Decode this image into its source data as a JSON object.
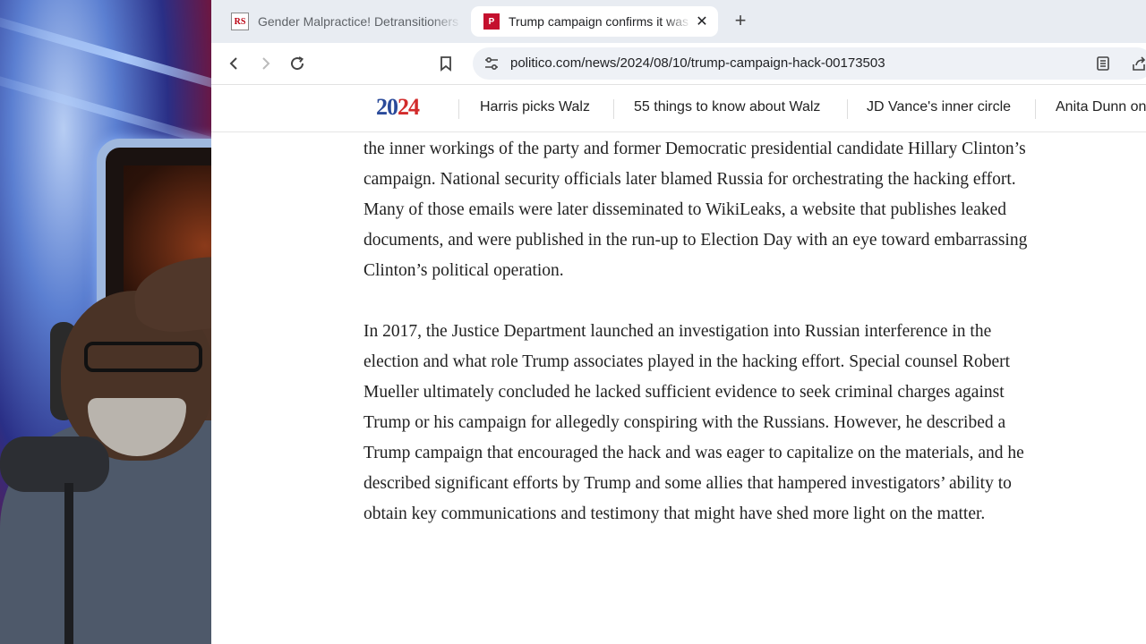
{
  "tabs": [
    {
      "favicon": "RS",
      "title": "Gender Malpractice! Detransitioners",
      "active": false
    },
    {
      "favicon": "P",
      "title": "Trump campaign confirms it was hacked",
      "active": true
    }
  ],
  "tab_close_glyph": "✕",
  "new_tab_glyph": "+",
  "address": {
    "url": "politico.com/news/2024/08/10/trump-campaign-hack-00173503"
  },
  "nav": {
    "logo_part1": "20",
    "logo_part2": "24",
    "links": [
      "Harris picks Walz",
      "55 things to know about Walz",
      "JD Vance's inner circle",
      "Anita Dunn on"
    ]
  },
  "article": {
    "paragraphs": [
      "the inner workings of the party and former Democratic presidential candidate Hillary Clinton’s campaign. National security officials later blamed Russia for orchestrating the hacking effort. Many of those emails were later disseminated to WikiLeaks, a website that publishes leaked documents, and were published in the run-up to Election Day with an eye toward embarrassing Clinton’s political operation.",
      "In 2017, the Justice Department launched an investigation into Russian interference in the election and what role Trump associates played in the hacking effort. Special counsel Robert Mueller ultimately concluded he lacked sufficient evidence to seek criminal charges against Trump or his campaign for allegedly conspiring with the Russians. However, he described a Trump campaign that encouraged the hack and was eager to capitalize on the materials, and he described significant efforts by Trump and some allies that hampered investigators’ ability to obtain key communications and testimony that might have shed more light on the matter."
    ]
  },
  "colors": {
    "politico_red": "#c4102e",
    "logo_blue": "#2a4a9a",
    "logo_red": "#d22b2b",
    "tabbar": "#e8ecf2"
  }
}
